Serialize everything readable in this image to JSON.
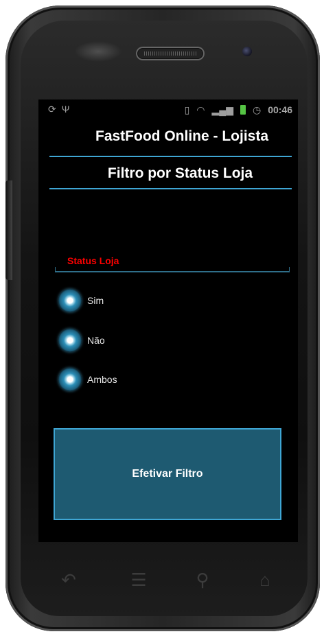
{
  "statusbar": {
    "left_icons": [
      "sync-icon",
      "usb-icon"
    ],
    "right_icons": [
      "vibrate-icon",
      "wifi-icon",
      "signal-icon",
      "battery-icon",
      "alarm-icon"
    ],
    "time": "00:46"
  },
  "app": {
    "title": "FastFood Online - Lojista",
    "section_title": "Filtro por Status Loja"
  },
  "form": {
    "field_label": "Status Loja",
    "options": [
      {
        "label": "Sim",
        "icon": "radio-icon"
      },
      {
        "label": "Não",
        "icon": "radio-icon"
      },
      {
        "label": "Ambos",
        "icon": "radio-icon"
      }
    ],
    "submit_label": "Efetivar Filtro"
  },
  "navigation": {
    "buttons": [
      "back-icon",
      "menu-icon",
      "search-icon",
      "home-icon"
    ]
  },
  "colors": {
    "accent": "#3fa6d4",
    "label_red": "#ff0000",
    "button_bg": "#1e5a71",
    "screen_bg": "#000000"
  }
}
